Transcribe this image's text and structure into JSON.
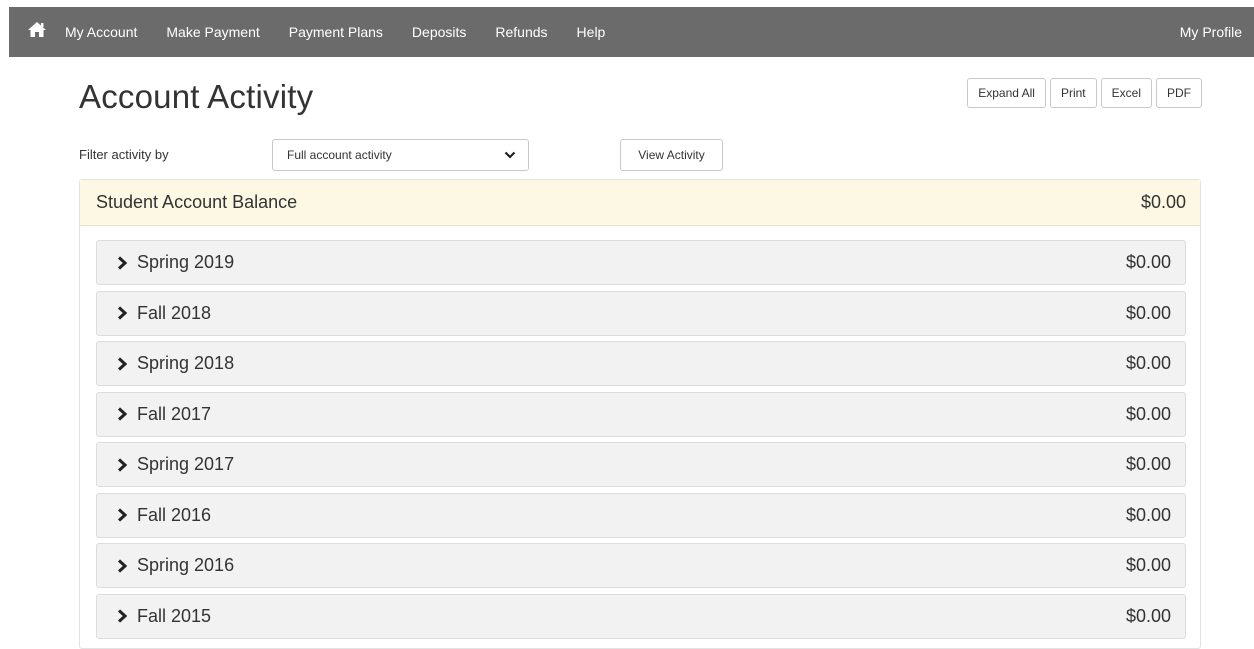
{
  "nav": {
    "links": [
      "My Account",
      "Make Payment",
      "Payment Plans",
      "Deposits",
      "Refunds",
      "Help"
    ],
    "profile": "My Profile",
    "home_icon": "home-icon"
  },
  "page": {
    "title": "Account Activity"
  },
  "actions": {
    "expand_all": "Expand All",
    "print": "Print",
    "excel": "Excel",
    "pdf": "PDF"
  },
  "filter": {
    "label": "Filter activity by",
    "selected": "Full account activity",
    "view_button": "View Activity"
  },
  "balance": {
    "label": "Student Account Balance",
    "amount": "$0.00",
    "header_color": "#fcf8e3"
  },
  "terms": [
    {
      "name": "Spring 2019",
      "amount": "$0.00"
    },
    {
      "name": "Fall 2018",
      "amount": "$0.00"
    },
    {
      "name": "Spring 2018",
      "amount": "$0.00"
    },
    {
      "name": "Fall 2017",
      "amount": "$0.00"
    },
    {
      "name": "Spring 2017",
      "amount": "$0.00"
    },
    {
      "name": "Fall 2016",
      "amount": "$0.00"
    },
    {
      "name": "Spring 2016",
      "amount": "$0.00"
    },
    {
      "name": "Fall 2015",
      "amount": "$0.00"
    }
  ],
  "colors": {
    "navbar": "#6b6b6b",
    "term_row": "#f2f2f2"
  }
}
